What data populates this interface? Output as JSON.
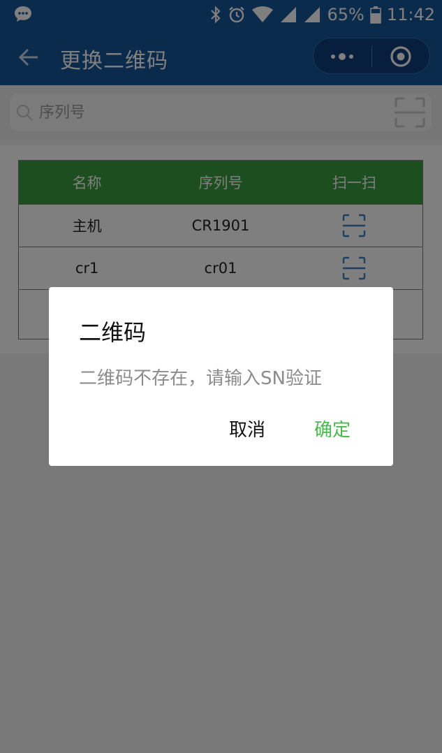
{
  "status_bar": {
    "battery_percent": "65%",
    "time": "11:42",
    "icons": [
      "chat-icon",
      "bluetooth-icon",
      "alarm-icon",
      "wifi-icon",
      "signal-icon",
      "signal-icon",
      "battery-icon"
    ]
  },
  "nav": {
    "title": "更换二维码",
    "icons": [
      "back-arrow-icon",
      "more-dots-icon",
      "target-icon"
    ]
  },
  "search": {
    "placeholder": "序列号",
    "value": ""
  },
  "table": {
    "headers": [
      "名称",
      "序列号",
      "扫一扫"
    ],
    "rows": [
      {
        "name": "主机",
        "serial": "CR1901"
      },
      {
        "name": "cr1",
        "serial": "cr01"
      },
      {
        "name": "",
        "serial": ""
      }
    ]
  },
  "dialog": {
    "title": "二维码",
    "message": "二维码不存在，请输入SN验证",
    "cancel_label": "取消",
    "confirm_label": "确定"
  },
  "colors": {
    "nav_bg": "#17569b",
    "table_header_bg": "#3a9c3e",
    "confirm_text": "#4cb84f",
    "scan_icon": "#3a7fc0"
  }
}
